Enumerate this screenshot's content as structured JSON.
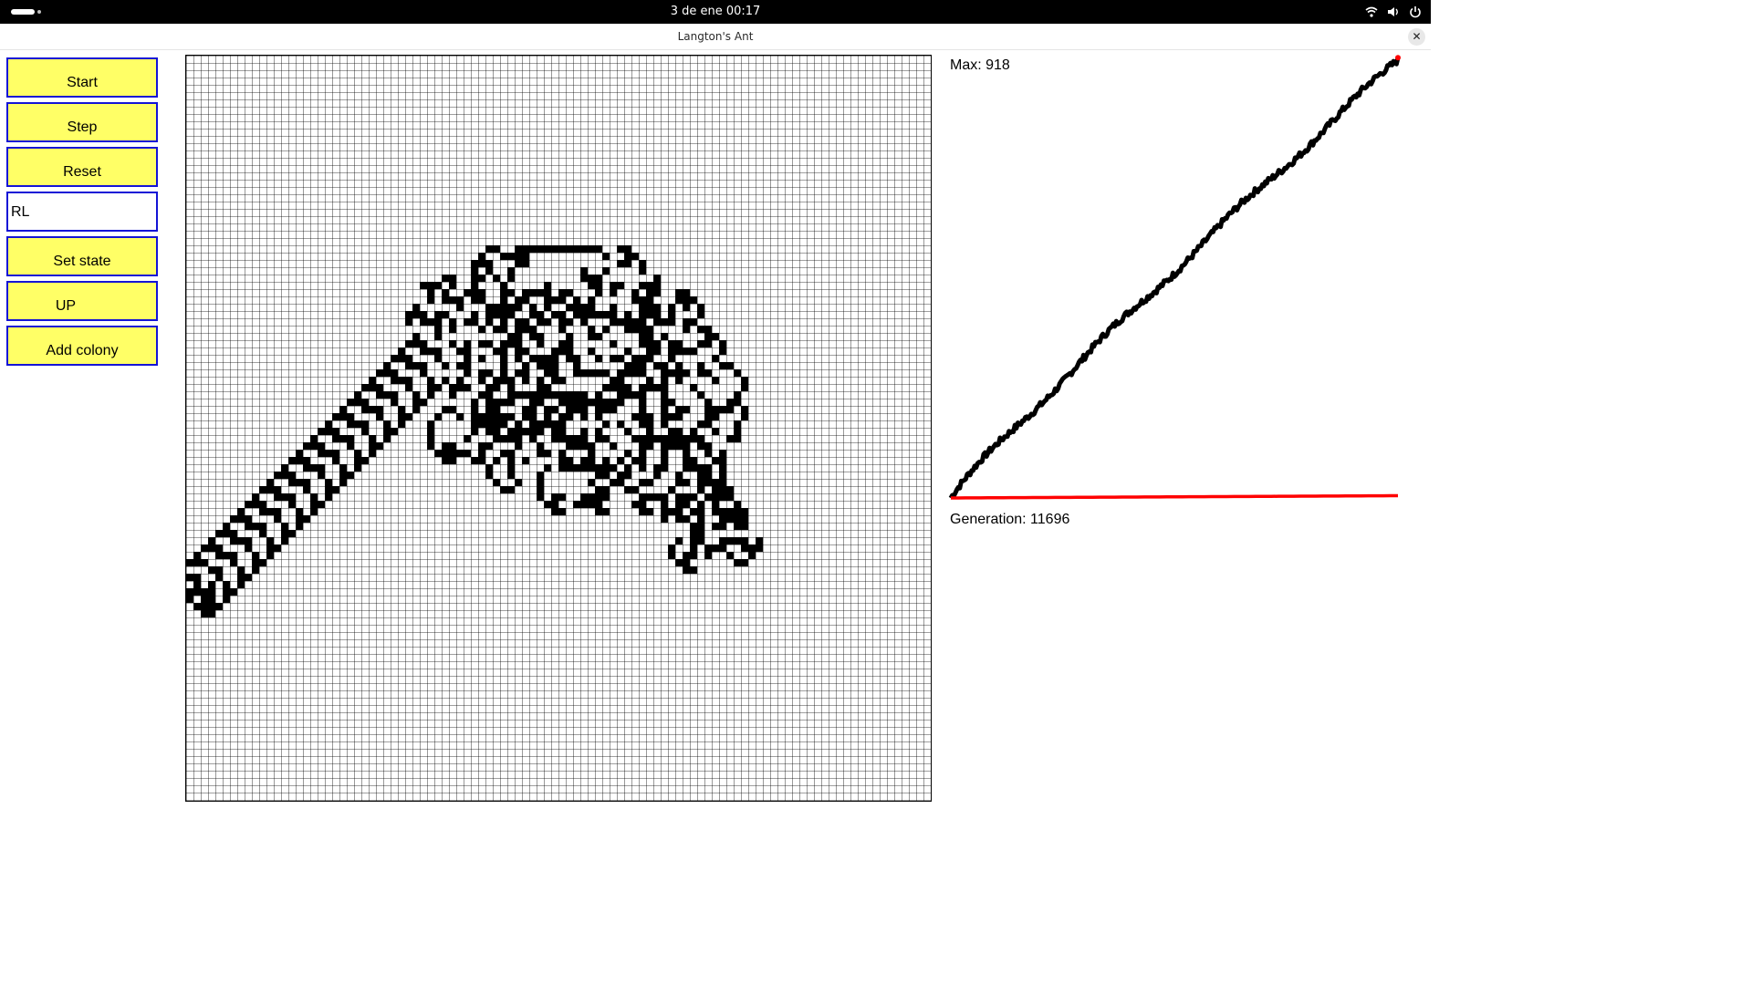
{
  "system_bar": {
    "clock": "3 de ene  00:17",
    "icons": [
      "wifi-icon",
      "volume-icon",
      "power-icon"
    ]
  },
  "window": {
    "title": "Langton's Ant",
    "close_icon": "close-icon"
  },
  "controls": {
    "start_label": "Start",
    "step_label": "Step",
    "reset_label": "Reset",
    "rule_value": "RL",
    "set_state_label": "Set state",
    "direction_label": "UP",
    "add_colony_label": "Add colony"
  },
  "stats": {
    "max_text": "Max: 918",
    "generation_text": "Generation: 11696"
  },
  "colors": {
    "button_fill": "#ffff66",
    "button_border": "#1414d6",
    "ant_cell": "#ff1a1a",
    "live_cell": "#000000",
    "series_black": "#000000",
    "series_red": "#ff0000"
  }
}
